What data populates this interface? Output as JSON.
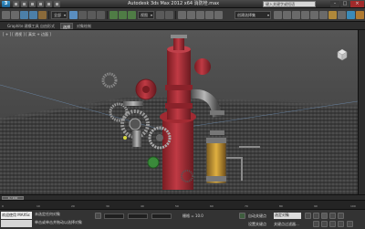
{
  "titlebar": {
    "title": "Autodesk 3ds Max 2012 x64   消防栓.max",
    "search_text": "键入关键字或短语",
    "minimize": "–",
    "maximize": "□",
    "close": "×"
  },
  "toolbar": {
    "selection_filter": "全部",
    "view_mode": "视图",
    "named_selection": "创建选择集"
  },
  "ribbon": {
    "tabs": [
      "Graphite 建模工具",
      "自由形式",
      "选择",
      "对象绘制"
    ],
    "active_tab": 2
  },
  "viewport": {
    "label": "[ + ] [ 透视 ] [ 真实 + 边面 ]"
  },
  "timeline": {
    "slider_text": "0 / 100",
    "ticks": [
      "0",
      "10",
      "20",
      "30",
      "40",
      "50",
      "60",
      "70",
      "80",
      "90",
      "100"
    ]
  },
  "statusbar": {
    "maxscript_text": "欢迎使用 MAXSc",
    "status_line1": "未选定任何对象",
    "status_line2": "单击或单击并拖动以选择对象",
    "grid_label": "栅格 = 10.0",
    "auto_key_label": "自动关键点",
    "selected_option": "选定对象",
    "set_key_label": "设置关键点",
    "key_filter_label": "关键点过滤器..."
  },
  "colors": {
    "hydrant_red": "#b5303a",
    "pipe_silver": "#9a9a9a",
    "ground": "#3a3a3a",
    "accent_blue": "#3f9fd8"
  }
}
